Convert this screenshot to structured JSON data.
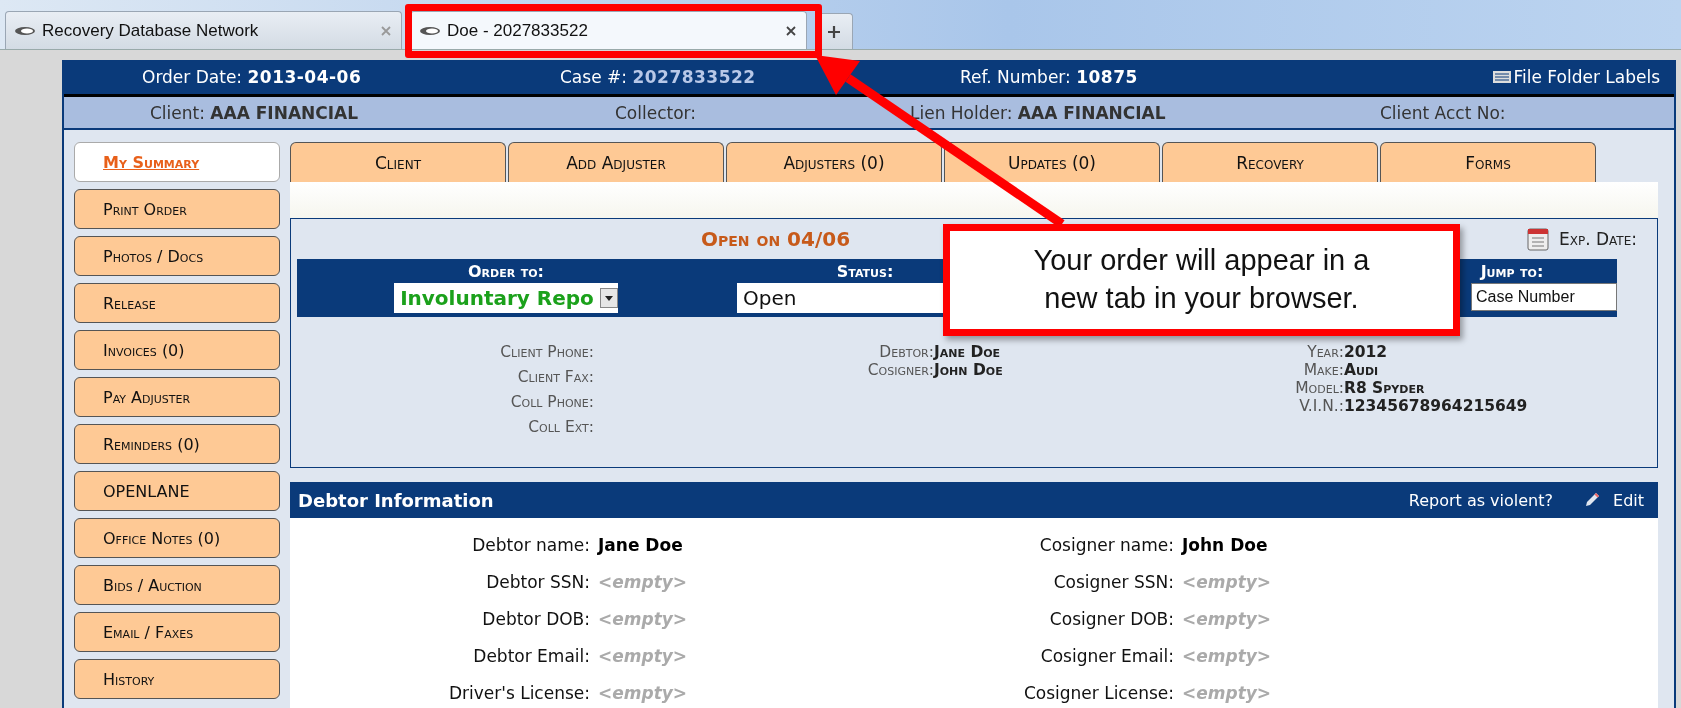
{
  "browser_tabs": [
    {
      "title": "Recovery Database Network",
      "selected": false
    },
    {
      "title": "Doe - 2027833522",
      "selected": true
    }
  ],
  "header": {
    "order_date_label": "Order Date:",
    "order_date": "2013-04-06",
    "case_label": "Case #:",
    "case_number": "2027833522",
    "ref_label": "Ref. Number:",
    "ref_number": "10875",
    "labels_link": "File Folder Labels"
  },
  "subheader": [
    {
      "label": "Client:",
      "value": "AAA FINANCIAL"
    },
    {
      "label": "Collector:"
    },
    {
      "label": "Lien Holder:",
      "value": "AAA FINANCIAL"
    },
    {
      "label": "Client Acct No:"
    }
  ],
  "side_tabs": [
    {
      "label": "My Summary",
      "selected": true
    },
    {
      "label": "Print Order",
      "selected": false
    },
    {
      "label": "Photos / Docs",
      "selected": false
    },
    {
      "label": "Release",
      "selected": false
    },
    {
      "label": "Invoices (0)",
      "selected": false
    },
    {
      "label": "Pay Adjuster",
      "selected": false
    },
    {
      "label": "Reminders (0)",
      "selected": false
    },
    {
      "label": "OPENLANE",
      "selected": false
    },
    {
      "label": "Office Notes (0)",
      "selected": false
    },
    {
      "label": "Bids / Auction",
      "selected": false
    },
    {
      "label": "Email / Faxes",
      "selected": false
    },
    {
      "label": "History",
      "selected": false
    }
  ],
  "top_tabs": [
    {
      "label": "Client",
      "selected": false
    },
    {
      "label": "Add Adjuster",
      "selected": false
    },
    {
      "label": "Adjusters (0)",
      "selected": false
    },
    {
      "label": "Updates (0)",
      "selected": false
    },
    {
      "label": "Recovery",
      "selected": false
    },
    {
      "label": "Forms",
      "selected": false
    }
  ],
  "summary": {
    "title": "Open on 04/06",
    "exp_label": "Exp. Date:",
    "order_to": {
      "label": "Order to:",
      "value": "Involuntary Repo"
    },
    "status": {
      "label": "Status:",
      "value": "Open"
    },
    "jump_to": {
      "label": "Jump to:",
      "placeholder": "Case Number"
    },
    "contact_fields": [
      {
        "label": "Client Phone:"
      },
      {
        "label": "Client Fax:"
      },
      {
        "label": "Coll Phone:"
      },
      {
        "label": "Coll Ext:"
      }
    ],
    "parties": [
      {
        "label": "Debtor:",
        "value": "Jane Doe"
      },
      {
        "label": "Cosigner:",
        "value": "John Doe"
      }
    ],
    "vehicle": [
      {
        "label": "Year:",
        "value": "2012"
      },
      {
        "label": "Make:",
        "value": "Audi"
      },
      {
        "label": "Model:",
        "value": "R8 Spyder"
      },
      {
        "label": "V.I.N.:",
        "value": "12345678964215649"
      }
    ]
  },
  "debtor_section": {
    "title": "Debtor Information",
    "report_link": "Report as violent?",
    "edit_link": "Edit",
    "debtor_fields": [
      {
        "label": "Debtor name:",
        "value": "Jane Doe",
        "empty": false
      },
      {
        "label": "Debtor SSN:",
        "value": "<empty>",
        "empty": true
      },
      {
        "label": "Debtor DOB:",
        "value": "<empty>",
        "empty": true
      },
      {
        "label": "Debtor Email:",
        "value": "<empty>",
        "empty": true
      },
      {
        "label": "Driver's License:",
        "value": "<empty>",
        "empty": true
      }
    ],
    "cosigner_fields": [
      {
        "label": "Cosigner name:",
        "value": "John Doe",
        "empty": false
      },
      {
        "label": "Cosigner SSN:",
        "value": "<empty>",
        "empty": true
      },
      {
        "label": "Cosigner DOB:",
        "value": "<empty>",
        "empty": true
      },
      {
        "label": "Cosigner Email:",
        "value": "<empty>",
        "empty": true
      },
      {
        "label": "Cosigner License:",
        "value": "<empty>",
        "empty": true
      }
    ]
  },
  "callout": {
    "text": "Your order will appear in a new tab in your browser."
  }
}
